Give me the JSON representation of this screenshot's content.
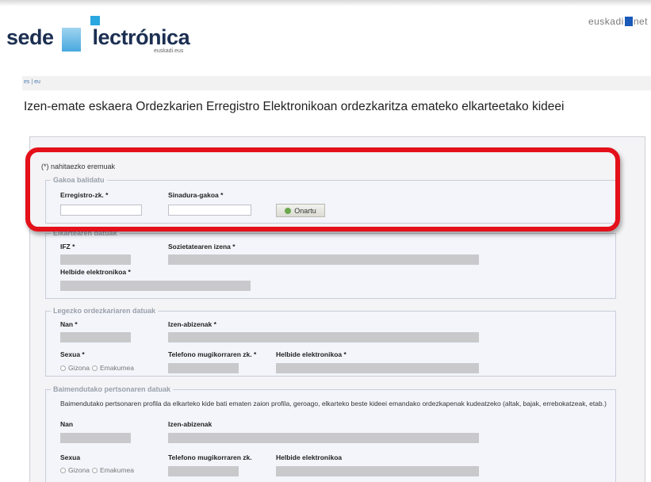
{
  "header": {
    "logo": {
      "word1": "sede",
      "e_letter": "e",
      "word2_rest": "lectrónica",
      "subtitle": "euskadi.eus"
    },
    "euskadi_prefix": "euskadi",
    "euskadi_suffix": "net"
  },
  "lang": {
    "es": "es",
    "separator": "|",
    "eu": "eu"
  },
  "page_title": "Izen-emate eskaera Ordezkarien Erregistro Elektronikoan ordezkaritza emateko elkarteetako kideei",
  "required_note": "(*) nahitaezko eremuak",
  "key_section": {
    "legend": "Gakoa balidatu",
    "reg_label": "Erregistro-zk. *",
    "reg_value": "",
    "sign_label": "Sinadura-gakoa *",
    "sign_value": "",
    "button_label": "Onartu"
  },
  "association": {
    "legend": "Elkartearen datuak",
    "nif_label": "IFZ *",
    "name_label": "Sozietatearen izena *",
    "email_label": "Helbide elektronikoa *"
  },
  "legal_rep": {
    "legend": "Legezko ordezkariaren datuak",
    "id_label": "Nan *",
    "name_label": "Izen-abizenak *",
    "sex_label": "Sexua *",
    "phone_label": "Telefono mugikorraren zk. *",
    "email_label": "Helbide elektronikoa *",
    "male": "Gizona",
    "female": "Emakumea"
  },
  "authorized": {
    "legend": "Baimendutako pertsonaren datuak",
    "description": "Baimendutako pertsonaren profila da elkarteko kide bati ematen zaion profila, geroago, elkarteko beste kideei emandako ordezkapenak kudeatzeko (altak, bajak, errebokatzeak, etab.)",
    "id_label": "Nan",
    "name_label": "Izen-abizenak",
    "sex_label": "Sexua",
    "phone_label": "Telefono mugikorraren zk.",
    "email_label": "Helbide elektronikoa",
    "male": "Gizona",
    "female": "Emakumea"
  },
  "colors": {
    "highlight": "#e4101a",
    "brand": "#1c2f52",
    "accent": "#29a7e1"
  }
}
